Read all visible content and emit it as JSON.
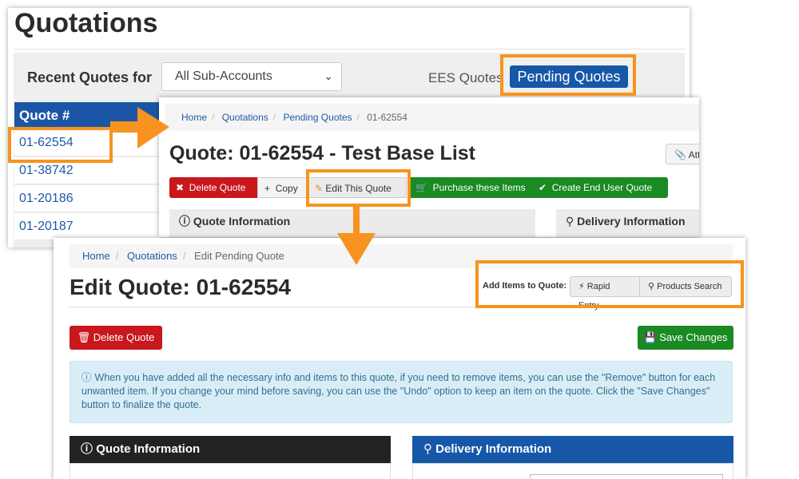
{
  "panel1": {
    "title": "Quotations",
    "recent_label": "Recent Quotes for",
    "subaccount_select": "All Sub-Accounts",
    "ees_label": "EES Quotes",
    "pending_button": "Pending Quotes",
    "table_header": "Quote #",
    "quotes": [
      "01-62554",
      "01-38742",
      "01-20186",
      "01-20187"
    ]
  },
  "panel2": {
    "breadcrumb": [
      "Home",
      "Quotations",
      "Pending Quotes",
      "01-62554"
    ],
    "title": "Quote: 01-62554 - Test Base List",
    "attach_button": "Att",
    "buttons": {
      "delete": "Delete Quote",
      "copy": "Copy",
      "edit": "Edit This Quote",
      "purchase": "Purchase these Items",
      "end_user": "Create End User Quote"
    },
    "quote_info": "Quote Information",
    "delivery_info": "Delivery Information"
  },
  "panel3": {
    "breadcrumb": [
      "Home",
      "Quotations",
      "Edit Pending Quote"
    ],
    "title": "Edit Quote: 01-62554",
    "add_items_label": "Add Items to Quote:",
    "rapid_entry": "Rapid Entry",
    "products_search": "Products Search",
    "delete_button": "Delete Quote",
    "save_button": "Save Changes",
    "info_text": "When you have added all the necessary info and items to this quote, if you need to remove items, you can use the \"Remove\" button for each unwanted item. If you change your mind before saving, you can use the \"Undo\" option to keep an item on the quote. Click the \"Save Changes\" button to finalize the quote.",
    "quote_info": "Quote Information",
    "delivery_info": "Delivery Information"
  },
  "colors": {
    "highlight": "#f7931e",
    "primary": "#1657a8",
    "danger": "#c8171d",
    "success": "#1a8a23"
  }
}
